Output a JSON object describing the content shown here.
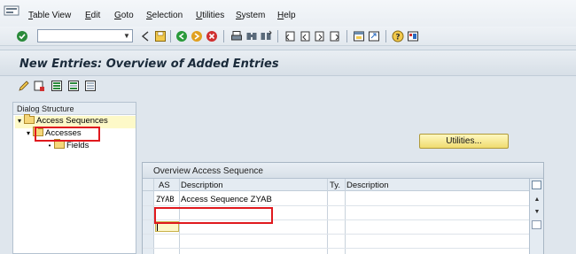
{
  "menubar": {
    "items": [
      {
        "label": "Table View",
        "key": "T",
        "rest": "able View"
      },
      {
        "label": "Edit",
        "key": "E",
        "rest": "dit"
      },
      {
        "label": "Goto",
        "key": "G",
        "rest": "oto"
      },
      {
        "label": "Selection",
        "key": "S",
        "rest": "election"
      },
      {
        "label": "Utilities",
        "key": "U",
        "rest": "tilities"
      },
      {
        "label": "System",
        "key": "S",
        "rest": "ystem"
      },
      {
        "label": "Help",
        "key": "H",
        "rest": "elp"
      }
    ]
  },
  "toolbar": {
    "command_field_value": "",
    "icons": [
      "enter-icon",
      "back-icon",
      "save-icon",
      "back-nav-icon",
      "exit-icon",
      "cancel-icon",
      "print-icon",
      "find-icon",
      "find-next-icon",
      "first-page-icon",
      "previous-page-icon",
      "next-page-icon",
      "last-page-icon",
      "create-session-icon",
      "shortcut-icon",
      "help-icon",
      "layout-icon"
    ]
  },
  "title": "New Entries: Overview of Added Entries",
  "app_toolbar": {
    "icons": [
      "display-change-icon",
      "delete-icon",
      "select-all-icon",
      "select-block-icon",
      "deselect-all-icon"
    ]
  },
  "dialog_structure": {
    "header": "Dialog Structure",
    "nodes": [
      {
        "label": "Access Sequences",
        "level": 0,
        "expanded": true,
        "selected": true
      },
      {
        "label": "Accesses",
        "level": 1,
        "expanded": true,
        "selected": false
      },
      {
        "label": "Fields",
        "level": 2,
        "expanded": false,
        "selected": false
      }
    ]
  },
  "utilities_button": "Utilities...",
  "table": {
    "title": "Overview Access Sequence",
    "columns": [
      "AS",
      "Description",
      "Ty.",
      "Description"
    ],
    "rows": [
      {
        "as": "ZYAB",
        "description": "Access Sequence ZYAB",
        "type": "",
        "type_description": ""
      }
    ]
  },
  "colors": {
    "highlight_border": "#e0191e",
    "selected_node_bg": "#fdf9c8",
    "button_bg": "#f0dc70",
    "title_text": "#1a2a3a"
  }
}
